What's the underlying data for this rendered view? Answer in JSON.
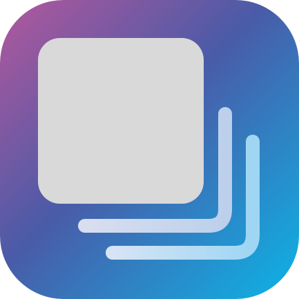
{
  "app_icon": {
    "icon": "stacked-layers-icon",
    "gradient": {
      "top_left": "#b3579c",
      "middle": "#4a5ba8",
      "bottom_right": "#0cb4e6"
    },
    "front_card_color": "#d9d9d9",
    "back_layer_colors": [
      "#ccd8ee",
      "#a8d8f2"
    ]
  }
}
